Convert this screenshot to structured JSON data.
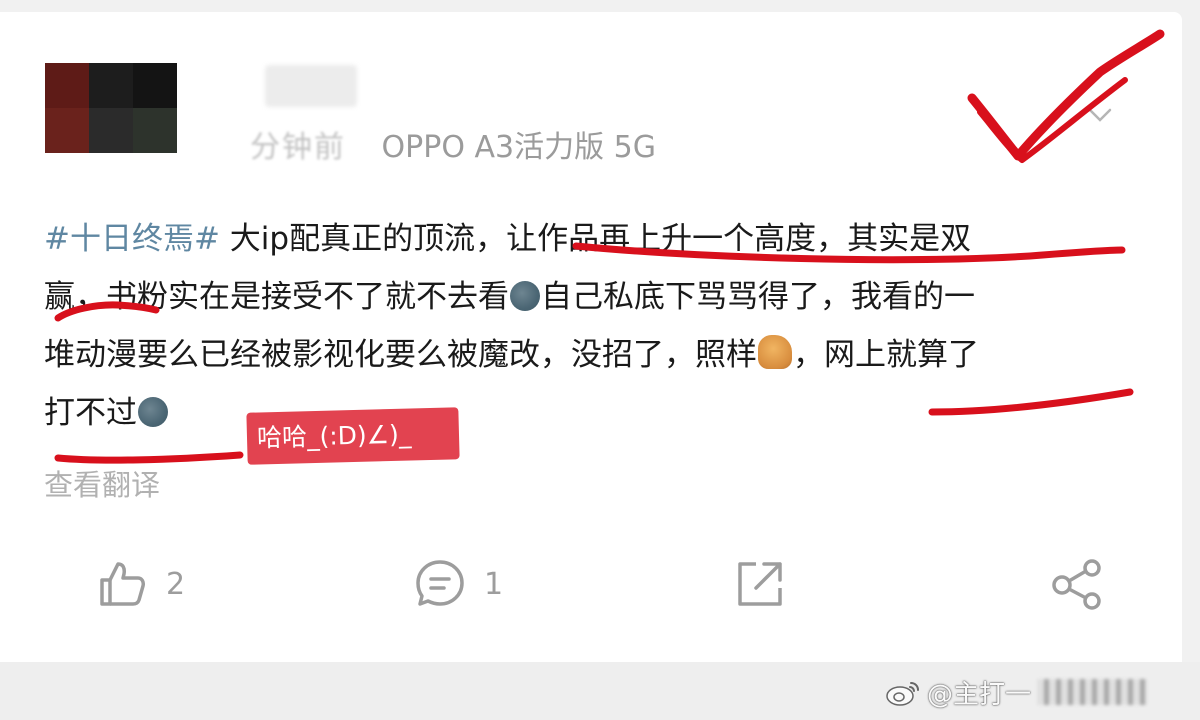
{
  "post": {
    "meta": {
      "time": "分钟前",
      "device": "OPPO A3活力版 5G"
    },
    "text_lines": [
      {
        "hashtag": "#十日终焉#",
        "text": " 大ip配真正的顶流，让作品再上升一个高度，其实是双"
      },
      {
        "before": "赢，书粉实在是接受不了就不去看",
        "after": "自己私底下骂骂得了，我看的一"
      },
      {
        "before": "堆动漫要么已经被影视化要么被魔改，没招了，照样",
        "after": "，网上就算了"
      },
      {
        "before": "打不过",
        "after": ""
      }
    ],
    "emojis": [
      "moon-face",
      "horse-face",
      "moon-face"
    ],
    "translate_label": "查看翻译",
    "sticker_text": "哈哈_(:D)∠)_"
  },
  "actions": {
    "like_count": "2",
    "comment_count": "1"
  },
  "watermark": {
    "handle": "@主打一"
  },
  "colors": {
    "hashtag": "#5f87a2",
    "annotation_red": "#d8101c",
    "sticker_bg": "#e24350",
    "meta_gray": "#9b9b9b"
  }
}
